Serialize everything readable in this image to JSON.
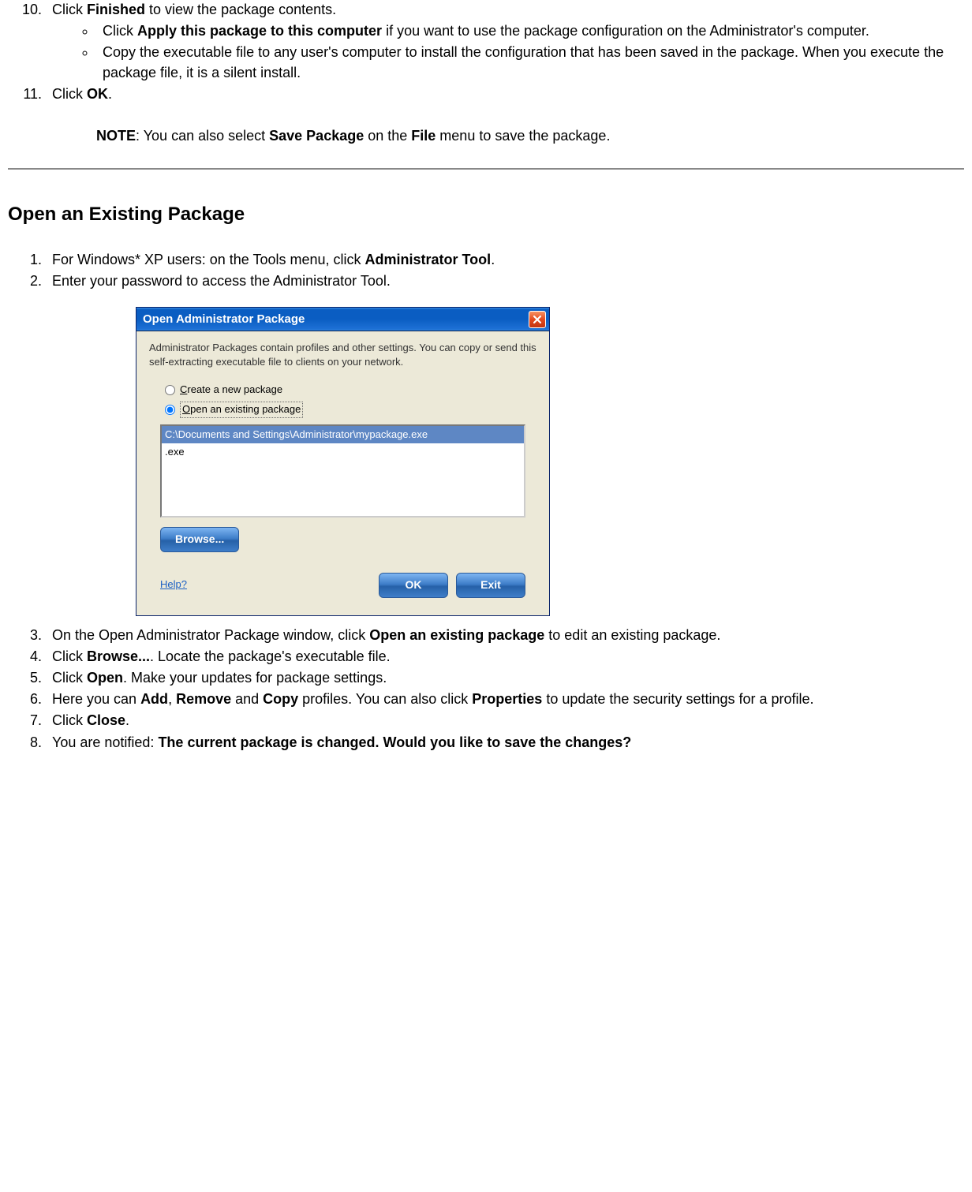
{
  "section1": {
    "item10_pre": "Click ",
    "item10_bold": "Finished",
    "item10_post": " to view the package contents.",
    "sub1_pre": "Click ",
    "sub1_bold": "Apply this package to this computer",
    "sub1_post": " if you want to use the package configuration on the Administrator's computer.",
    "sub2": "Copy the executable file to any user's computer to install the configuration that has been saved in the package. When you execute the package file, it is a silent install.",
    "item11_pre": "Click ",
    "item11_bold": "OK",
    "item11_post": ".",
    "note_label": "NOTE",
    "note_mid1": ": You can also select ",
    "note_b1": "Save Package",
    "note_mid2": " on the ",
    "note_b2": "File",
    "note_post": " menu to save the package."
  },
  "heading2": "Open an Existing Package",
  "section2": {
    "item1_pre": "For Windows* XP users: on the Tools menu, click ",
    "item1_bold": "Administrator Tool",
    "item1_post": ".",
    "item2": "Enter your password to access the Administrator Tool.",
    "item3_pre": "On the Open Administrator Package window, click ",
    "item3_bold": "Open an existing package",
    "item3_post": " to edit an existing package.",
    "item4_pre": "Click ",
    "item4_bold": "Browse...",
    "item4_post": ". Locate the package's executable file.",
    "item5_pre": "Click ",
    "item5_bold": "Open",
    "item5_post": ". Make your updates for package settings.",
    "item6_pre": "Here you can ",
    "item6_b1": "Add",
    "item6_m1": ", ",
    "item6_b2": "Remove",
    "item6_m2": " and ",
    "item6_b3": "Copy",
    "item6_m3": " profiles. You can also click ",
    "item6_b4": "Properties",
    "item6_post": " to update the security settings for a profile.",
    "item7_pre": "Click ",
    "item7_bold": "Close",
    "item7_post": ".",
    "item8_pre": "You are notified: ",
    "item8_bold": "The current package is changed. Would you like to save the changes?"
  },
  "dialog": {
    "title": "Open Administrator Package",
    "desc": "Administrator Packages contain profiles and other settings. You can copy or send this self-extracting executable file to clients on your network.",
    "radio1": "Create a new package",
    "radio2": "Open an existing package",
    "list_sel": "C:\\Documents and Settings\\Administrator\\mypackage.exe",
    "list_item": ".exe",
    "browse": "Browse...",
    "help": "Help?",
    "ok": "OK",
    "exit": "Exit"
  }
}
